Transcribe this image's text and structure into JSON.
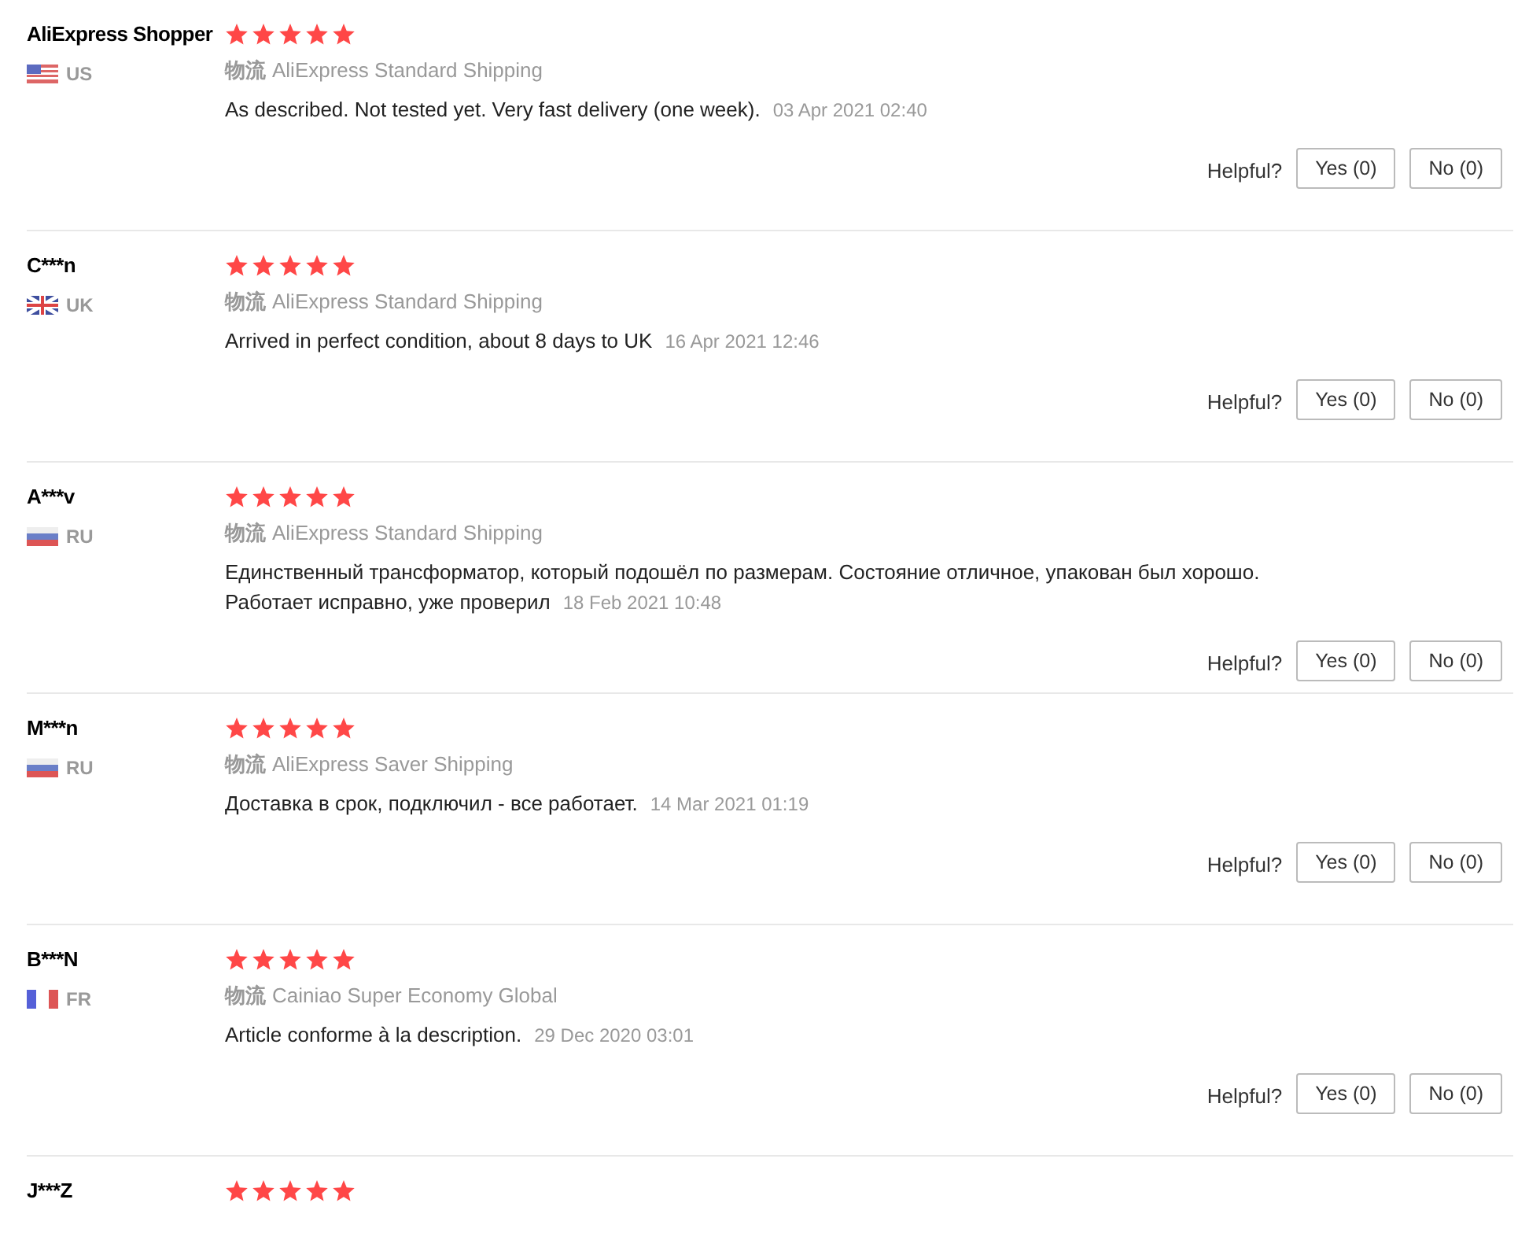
{
  "reviews": [
    {
      "name": "AliExpress Shopper",
      "flag": {
        "kind": "us"
      },
      "country": "US",
      "stars": 5,
      "shipping_label": "物流",
      "shipping": "AliExpress Standard Shipping",
      "text": "As described. Not tested yet. Very fast delivery (one week).",
      "date": "03 Apr 2021 02:40",
      "helpful": "Helpful?",
      "yes": "Yes (0)",
      "no": "No (0)"
    },
    {
      "name": "C***n",
      "flag": {
        "kind": "uk"
      },
      "country": "UK",
      "stars": 5,
      "shipping_label": "物流",
      "shipping": "AliExpress Standard Shipping",
      "text": "Arrived in perfect condition, about 8 days to UK",
      "date": "16 Apr 2021 12:46",
      "helpful": "Helpful?",
      "yes": "Yes (0)",
      "no": "No (0)"
    },
    {
      "name": "A***v",
      "flag": {
        "kind": "ru"
      },
      "country": "RU",
      "stars": 5,
      "shipping_label": "物流",
      "shipping": "AliExpress Standard Shipping",
      "text": "Единственный трансформатор, который подошёл по размерам. Состояние отличное, упакован был хорошо. Работает исправно, уже проверил",
      "date": "18 Feb 2021 10:48",
      "helpful": "Helpful?",
      "yes": "Yes (0)",
      "no": "No (0)"
    },
    {
      "name": "M***n",
      "flag": {
        "kind": "ru"
      },
      "country": "RU",
      "stars": 5,
      "shipping_label": "物流",
      "shipping": "AliExpress Saver Shipping",
      "text": "Доставка в срок, подключил - все работает.",
      "date": "14 Mar 2021 01:19",
      "helpful": "Helpful?",
      "yes": "Yes (0)",
      "no": "No (0)"
    },
    {
      "name": "B***N",
      "flag": {
        "kind": "fr"
      },
      "country": "FR",
      "stars": 5,
      "shipping_label": "物流",
      "shipping": "Cainiao Super Economy Global",
      "text": "Article conforme à la description.",
      "date": "29 Dec 2020 03:01",
      "helpful": "Helpful?",
      "yes": "Yes (0)",
      "no": "No (0)"
    },
    {
      "name": "J***Z",
      "stars": 5
    }
  ]
}
